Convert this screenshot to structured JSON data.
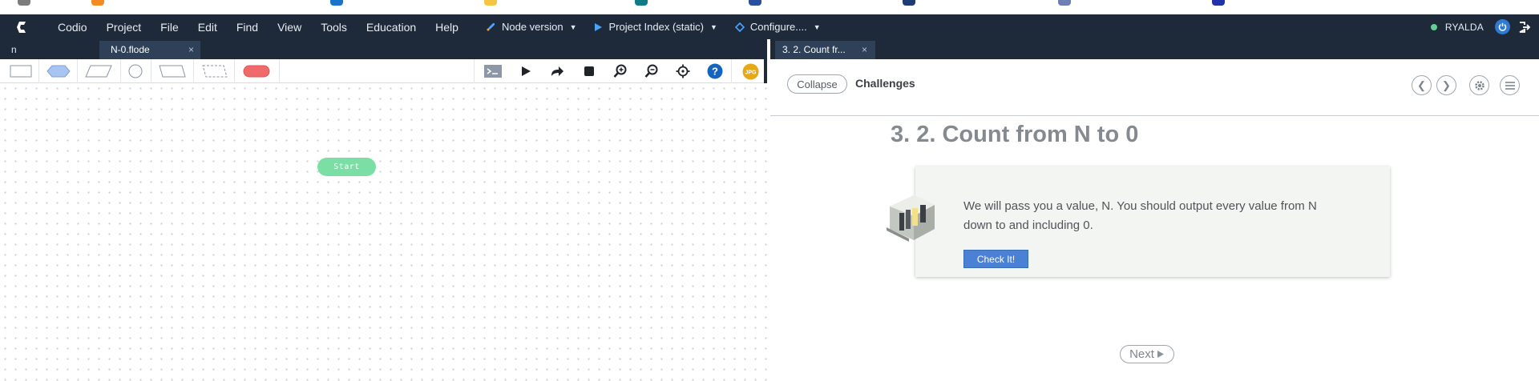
{
  "app": {
    "logo": "codio-logo",
    "menu": [
      "Codio",
      "Project",
      "File",
      "Edit",
      "Find",
      "View",
      "Tools",
      "Education",
      "Help"
    ],
    "tools": [
      {
        "label": "Node version",
        "icon": "rocket-icon"
      },
      {
        "label": "Project Index (static)",
        "icon": "play-icon"
      },
      {
        "label": "Configure....",
        "icon": "diamond-icon"
      }
    ],
    "user": "RYALDA",
    "status_color": "#5fd38d",
    "accent": "#2e7bd6"
  },
  "editor": {
    "tabs": [
      {
        "label": "n"
      },
      {
        "label": "N-0.flode",
        "close": "×"
      }
    ],
    "toolbar_shapes": [
      "process",
      "decision",
      "input-output",
      "connector",
      "manual-input",
      "comment",
      "terminator"
    ],
    "toolbar_buttons": [
      "terminal-icon",
      "run-icon",
      "step-icon",
      "stop-icon",
      "zoom-in-icon",
      "zoom-out-icon",
      "center-icon",
      "help-icon",
      "export-jpg-icon"
    ],
    "export_label": "JPG",
    "start_node": "Start",
    "start_color": "#7bdfa5"
  },
  "guide": {
    "tab": {
      "label": "3. 2. Count fr...",
      "close": "×"
    },
    "collapse": "Collapse",
    "section": "Challenges",
    "title": "3. 2. Count from N to 0",
    "body": "We will pass you a value, N. You should output every value from N down to and including 0.",
    "check_button": "Check It!",
    "next": "Next",
    "check_color": "#4a81d4"
  }
}
